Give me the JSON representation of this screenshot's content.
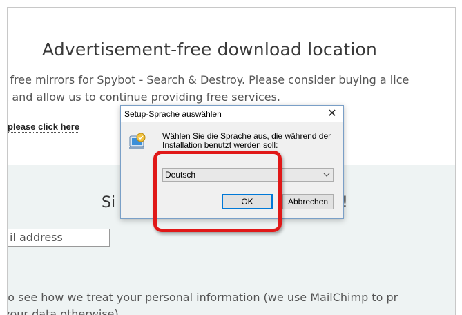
{
  "page": {
    "title": "Advertisement-free download location",
    "intro_line1": "t free mirrors for Spybot - Search & Destroy. Please consider buying a lice",
    "intro_line2": "k and allow us to continue providing free services.",
    "click_link": "please click here"
  },
  "newsletter": {
    "heading_start": "Si",
    "heading_end": "!",
    "email_placeholder": "il address",
    "privacy_line1": "to see how we treat your personal information (we use MailChimp to pr",
    "privacy_line2": "your data otherwise)"
  },
  "dialog": {
    "title": "Setup-Sprache auswählen",
    "close_glyph": "✕",
    "message": "Wählen Sie die Sprache aus, die während der Installation benutzt werden soll:",
    "selected_language": "Deutsch",
    "ok_label": "OK",
    "cancel_label": "Abbrechen",
    "icon": "setup-icon"
  },
  "colors": {
    "highlight": "#e01818",
    "dialog_focus": "#0078d7",
    "newsletter_bg": "#eef3f3"
  }
}
